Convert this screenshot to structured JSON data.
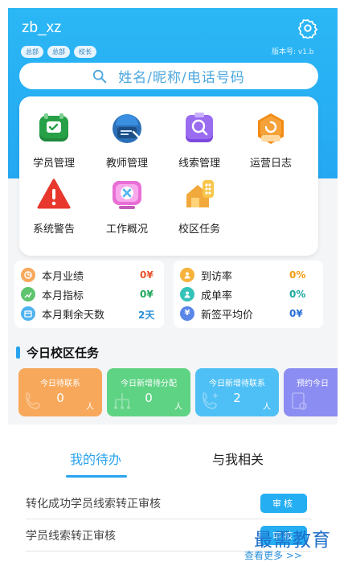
{
  "header": {
    "username": "zb_xz",
    "badges": [
      "总部",
      "总部",
      "校长"
    ],
    "version": "版本号:  v1.b",
    "settings_icon": "gear-icon"
  },
  "search": {
    "placeholder": "姓名/昵称/电话号码"
  },
  "menu": {
    "items": [
      {
        "label": "学员管理",
        "icon": "student-check-icon"
      },
      {
        "label": "教师管理",
        "icon": "teacher-icon"
      },
      {
        "label": "线索管理",
        "icon": "lead-search-icon"
      },
      {
        "label": "运营日志",
        "icon": "log-icon"
      },
      {
        "label": "系统警告",
        "icon": "warning-icon"
      },
      {
        "label": "工作概况",
        "icon": "work-overview-icon"
      },
      {
        "label": "校区任务",
        "icon": "campus-task-icon"
      }
    ]
  },
  "stats_left": [
    {
      "label": "本月业绩",
      "value": "0¥",
      "color": "#e8542b"
    },
    {
      "label": "本月指标",
      "value": "0¥",
      "color": "#1fa65a"
    },
    {
      "label": "本月剩余天数",
      "value": "2天",
      "color": "#2a8fd8"
    }
  ],
  "stats_right": [
    {
      "label": "到访率",
      "value": "0%",
      "color": "#f29b12"
    },
    {
      "label": "成单率",
      "value": "0%",
      "color": "#1aa8a0"
    },
    {
      "label": "新签平均价",
      "value": "0¥",
      "color": "#2a6fd8"
    }
  ],
  "tasks": {
    "title": "今日校区任务",
    "cards": [
      {
        "title": "今日待联系",
        "value": "0",
        "unit": "人",
        "color": "#f7a85b"
      },
      {
        "title": "今日新增待分配",
        "value": "0",
        "unit": "人",
        "color": "#5fd384"
      },
      {
        "title": "今日新增待联系",
        "value": "2",
        "unit": "人",
        "color": "#4fc0f5"
      },
      {
        "title": "预约今日",
        "value": "",
        "unit": "",
        "color": "#8b8df2"
      }
    ]
  },
  "bottom": {
    "tabs": [
      "我的待办",
      "与我相关"
    ],
    "todos": [
      {
        "text": "转化成功学员线索转正审核",
        "button": "审核"
      },
      {
        "text": "学员线索转正审核",
        "button": "审核"
      }
    ],
    "more": "查看更多 >>",
    "watermark": "最需教育"
  }
}
